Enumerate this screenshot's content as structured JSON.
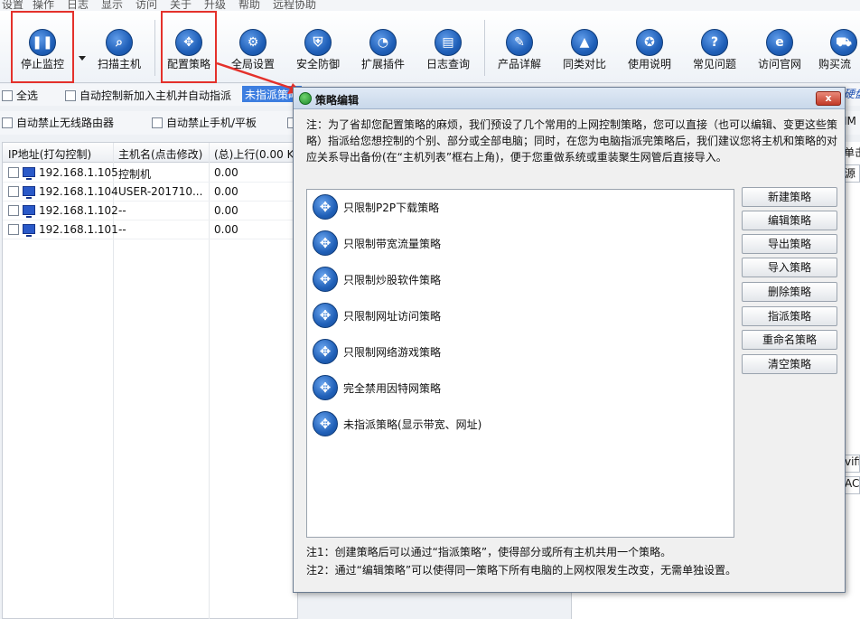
{
  "menu": [
    "设置",
    "操作",
    "日志",
    "显示",
    "访问",
    "关于",
    "升级",
    "帮助",
    "远程协助"
  ],
  "toolbar": [
    {
      "label": "停止监控",
      "icon": "pause-icon",
      "glyph": "❚❚"
    },
    {
      "label": "扫描主机",
      "icon": "search-icon",
      "glyph": "⌕"
    },
    {
      "label": "配置策略",
      "icon": "move-arrows-icon",
      "glyph": "✥"
    },
    {
      "label": "全局设置",
      "icon": "gear-icon",
      "glyph": "⚙"
    },
    {
      "label": "安全防御",
      "icon": "shield-icon",
      "glyph": "⛨"
    },
    {
      "label": "扩展插件",
      "icon": "pie-chart-icon",
      "glyph": "◔"
    },
    {
      "label": "日志查询",
      "icon": "log-book-icon",
      "glyph": "▤"
    },
    {
      "label": "产品详解",
      "icon": "pen-icon",
      "glyph": "✎"
    },
    {
      "label": "同类对比",
      "icon": "graduation-cap-icon",
      "glyph": "▲"
    },
    {
      "label": "使用说明",
      "icon": "medal-icon",
      "glyph": "✪"
    },
    {
      "label": "常见问题",
      "icon": "question-icon",
      "glyph": "?"
    },
    {
      "label": "访问官网",
      "icon": "ie-browser-icon",
      "glyph": "e"
    },
    {
      "label": "购买流",
      "icon": "cart-icon",
      "glyph": "⛟"
    }
  ],
  "options": {
    "select_all": "全选",
    "auto_control_new": "自动控制新加入主机并自动指派",
    "policy_combo": "未指派策略",
    "block_wifi_router": "自动禁止无线路由器",
    "block_mobile": "自动禁止手机/平板"
  },
  "table": {
    "headers": [
      "IP地址(打勾控制)",
      "主机名(点击修改)",
      "(总)上行(0.00 KB"
    ],
    "rows": [
      {
        "ip": "192.168.1.105",
        "name": "控制机",
        "up": "0.00"
      },
      {
        "ip": "192.168.1.104",
        "name": "USER-201710...",
        "up": "0.00"
      },
      {
        "ip": "192.168.1.102",
        "name": "--",
        "up": "0.00"
      },
      {
        "ip": "192.168.1.101",
        "name": "--",
        "up": "0.00"
      }
    ]
  },
  "right_fragments": {
    "r1": "硬盘",
    "r2": "IM",
    "r3": "单击",
    "r4": "源",
    "r5": "vifi",
    "r6": "AC"
  },
  "dialog": {
    "title": "策略编辑",
    "close": "x",
    "note": "注：为了省却您配置策略的麻烦，我们预设了几个常用的上网控制策略，您可以直接（也可以编辑、变更这些策略）指派给您想控制的个别、部分或全部电脑；同时，在您为电脑指派完策略后，我们建议您将主机和策略的对应关系导出备份(在“主机列表”框右上角)，便于您重做系统或重装聚生网管后直接导入。",
    "policies": [
      "只限制P2P下载策略",
      "只限制带宽流量策略",
      "只限制炒股软件策略",
      "只限制网址访问策略",
      "只限制网络游戏策略",
      "完全禁用因特网策略",
      "未指派策略(显示带宽、网址)"
    ],
    "buttons": [
      "新建策略",
      "编辑策略",
      "导出策略",
      "导入策略",
      "删除策略",
      "指派策略",
      "重命名策略",
      "清空策略"
    ],
    "foot1": "注1：创建策略后可以通过“指派策略”，使得部分或所有主机共用一个策略。",
    "foot2": "注2：通过“编辑策略”可以使得同一策略下所有电脑的上网权限发生改变，无需单独设置。"
  }
}
